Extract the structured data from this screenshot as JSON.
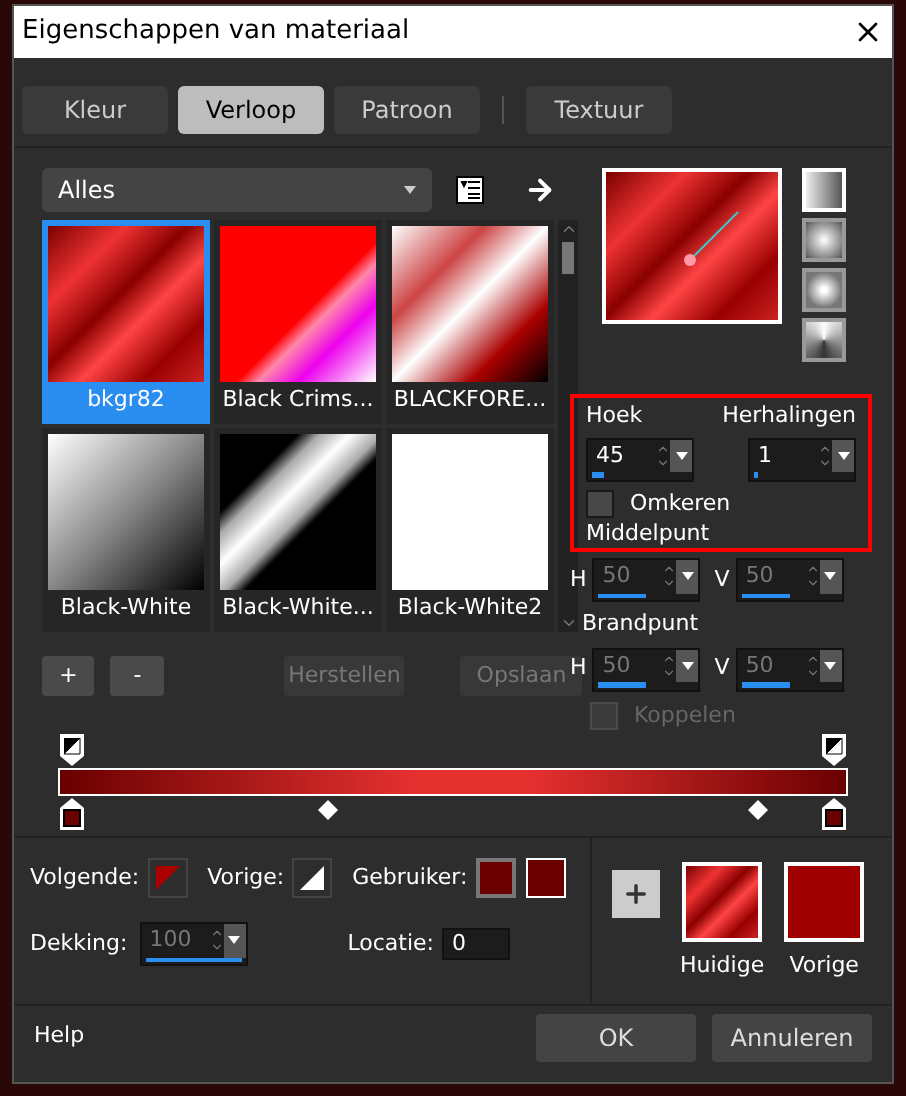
{
  "window": {
    "title": "Eigenschappen van materiaal"
  },
  "tabs": [
    {
      "label": "Kleur",
      "selected": false
    },
    {
      "label": "Verloop",
      "selected": true
    },
    {
      "label": "Patroon",
      "selected": false
    },
    {
      "label": "Textuur",
      "selected": false
    }
  ],
  "library": {
    "category": "Alles",
    "items": [
      {
        "name": "bkgr82",
        "selected": true
      },
      {
        "name": "Black Crims...",
        "selected": false
      },
      {
        "name": "BLACKFORE...",
        "selected": false
      },
      {
        "name": "Black-White",
        "selected": false
      },
      {
        "name": "Black-White...",
        "selected": false
      },
      {
        "name": "Black-White2",
        "selected": false
      }
    ]
  },
  "library_buttons": [
    {
      "label": "+",
      "disabled": false
    },
    {
      "label": "-",
      "disabled": false
    },
    {
      "label": "Herstellen",
      "disabled": true
    },
    {
      "label": "Opslaan",
      "disabled": true
    }
  ],
  "style_buttons": [
    {
      "selected": true
    },
    {
      "selected": false
    },
    {
      "selected": false
    },
    {
      "selected": false
    }
  ],
  "angle": {
    "label": "Hoek",
    "value": "45",
    "level": 0.125
  },
  "repeats": {
    "label": "Herhalingen",
    "value": "1",
    "level": 0.05
  },
  "invert": {
    "label": "Omkeren",
    "checked": false
  },
  "center": {
    "label": "Middelpunt",
    "disabled": true,
    "h_label": "H",
    "h": {
      "value": "50",
      "level": 0.5
    },
    "v_label": "V",
    "v": {
      "value": "50",
      "level": 0.5
    }
  },
  "focus": {
    "label": "Brandpunt",
    "disabled": true,
    "h_label": "H",
    "h": {
      "value": "50",
      "level": 0.5
    },
    "v_label": "V",
    "v": {
      "value": "50",
      "level": 0.5
    }
  },
  "link": {
    "label": "Koppelen",
    "checked": false,
    "disabled": true
  },
  "next_label": "Volgende:",
  "prev_label": "Vorige:",
  "user_label": "Gebruiker:",
  "opacity": {
    "label": "Dekking:",
    "disabled": true,
    "value": "100",
    "level": 1
  },
  "location": {
    "label": "Locatie:",
    "value": "0"
  },
  "current": {
    "label": "Huidige"
  },
  "previous": {
    "label": "Vorige"
  },
  "footer": {
    "help": "Help",
    "ok": "OK",
    "cancel": "Annuleren"
  }
}
